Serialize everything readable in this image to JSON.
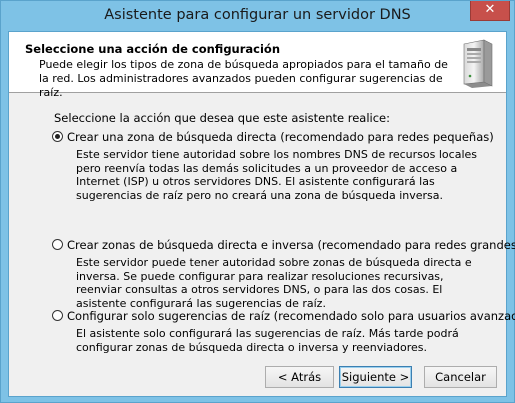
{
  "window": {
    "title": "Asistente para configurar un servidor DNS",
    "close_glyph": "✕"
  },
  "header": {
    "title": "Seleccione una acción de configuración",
    "description": "Puede elegir los tipos de zona de búsqueda apropiados para el tamaño de la red. Los administradores avanzados pueden configurar sugerencias de raíz.",
    "icon": "server-icon"
  },
  "body": {
    "prompt": "Seleccione la acción que desea que este asistente realice:",
    "options": [
      {
        "label": "Crear una zona de búsqueda directa (recomendado para redes pequeñas)",
        "description": "Este servidor tiene autoridad sobre los nombres DNS de recursos locales pero reenvía todas las demás solicitudes a un proveedor de acceso a Internet (ISP) u otros servidores DNS. El asistente configurará las sugerencias de raíz pero no creará una zona de búsqueda inversa.",
        "selected": true
      },
      {
        "label": "Crear zonas de búsqueda directa e inversa (recomendado para redes grandes)",
        "description": "Este servidor puede tener autoridad sobre zonas de búsqueda directa e inversa. Se puede configurar para realizar resoluciones recursivas, reenviar consultas a otros servidores DNS, o para las dos cosas. El asistente configurará las sugerencias de raíz.",
        "selected": false
      },
      {
        "label": "Configurar solo sugerencias de raíz (recomendado solo para usuarios avanzados)",
        "description": "El asistente solo configurará las sugerencias de raíz. Más tarde podrá configurar zonas de búsqueda directa o inversa y reenviadores.",
        "selected": false
      }
    ]
  },
  "buttons": {
    "back": "< Atrás",
    "next": "Siguiente >",
    "cancel": "Cancelar"
  }
}
